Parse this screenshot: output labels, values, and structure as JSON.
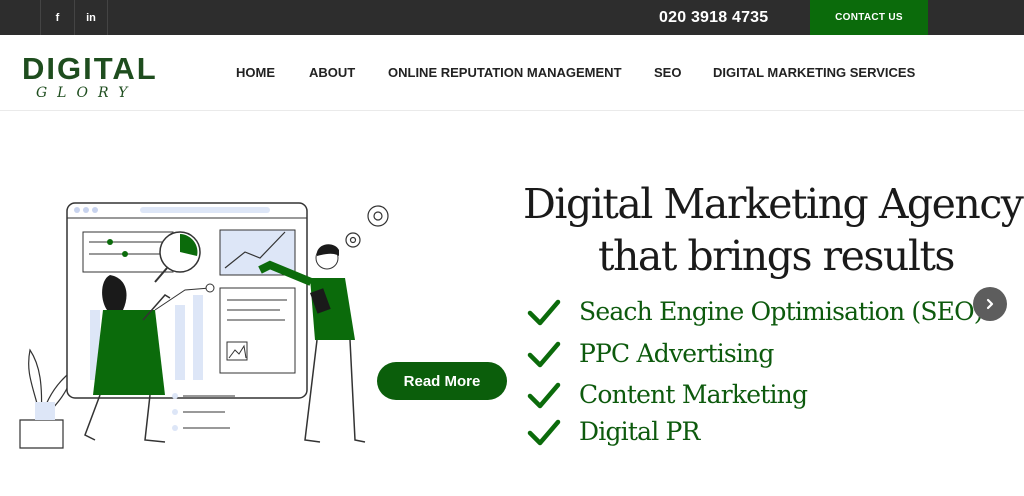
{
  "topbar": {
    "facebook_label": "f",
    "linkedin_label": "in",
    "phone": "020 3918 4735",
    "contact_label": "CONTACT US"
  },
  "logo": {
    "main": "DIGITAL",
    "sub": "GLORY"
  },
  "nav": {
    "items": [
      {
        "label": "HOME"
      },
      {
        "label": "ABOUT"
      },
      {
        "label": "ONLINE REPUTATION MANAGEMENT"
      },
      {
        "label": "SEO"
      },
      {
        "label": "DIGITAL MARKETING SERVICES"
      }
    ]
  },
  "hero": {
    "headline_line1": "Digital Marketing Agency",
    "headline_line2": "that brings results",
    "services": [
      "Seach Engine Optimisation (SEO)",
      "PPC Advertising",
      "Content Marketing",
      "Digital PR"
    ],
    "read_more_label": "Read More"
  },
  "colors": {
    "brand_green": "#0b6b0b",
    "topbar_bg": "#2d2d2d",
    "service_text": "#0d5a0d"
  },
  "icons": {
    "facebook": "facebook-icon",
    "linkedin": "linkedin-icon",
    "check": "check-icon",
    "next": "chevron-right-icon"
  }
}
